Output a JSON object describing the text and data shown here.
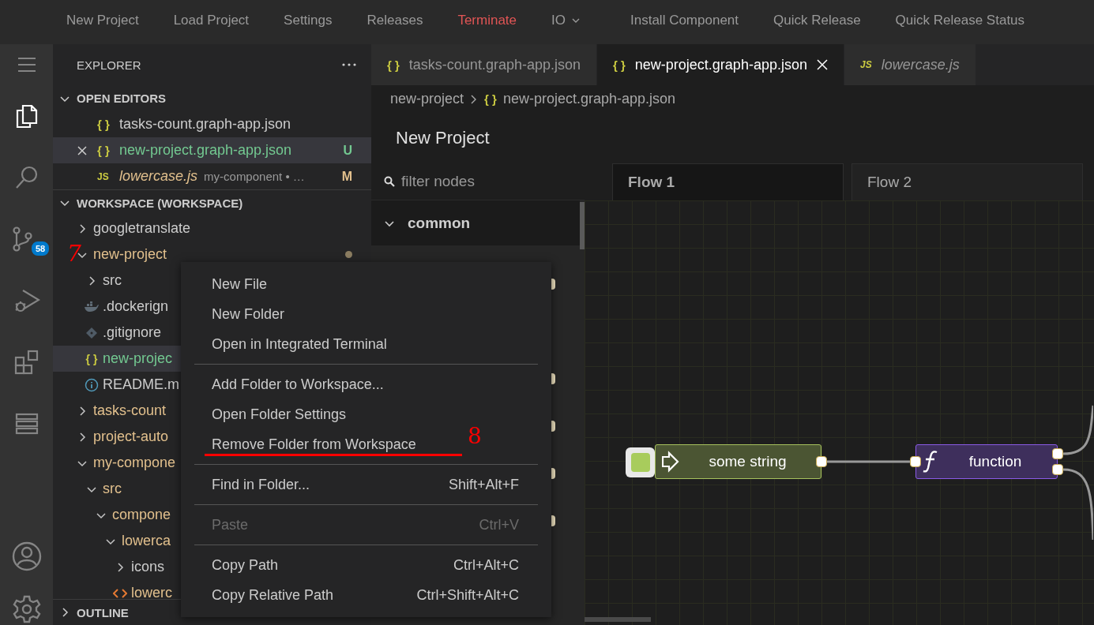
{
  "menu_bar": [
    {
      "label": "New Project",
      "danger": false,
      "dropdown": false
    },
    {
      "label": "Load Project",
      "danger": false,
      "dropdown": false
    },
    {
      "label": "Settings",
      "danger": false,
      "dropdown": false
    },
    {
      "label": "Releases",
      "danger": false,
      "dropdown": false
    },
    {
      "label": "Terminate",
      "danger": true,
      "dropdown": false
    },
    {
      "label": "IO",
      "danger": false,
      "dropdown": true
    },
    {
      "label": "Install Component",
      "danger": false,
      "dropdown": false
    },
    {
      "label": "Quick Release",
      "danger": false,
      "dropdown": false
    },
    {
      "label": "Quick Release Status",
      "danger": false,
      "dropdown": false
    }
  ],
  "activity_bar": {
    "items": [
      {
        "kind": "menu",
        "selected": false
      },
      {
        "kind": "files",
        "selected": true
      },
      {
        "kind": "search",
        "selected": false
      },
      {
        "kind": "source-control",
        "selected": false,
        "badge": "58"
      },
      {
        "kind": "debug",
        "selected": false
      },
      {
        "kind": "extensions",
        "selected": false
      },
      {
        "kind": "ruler",
        "selected": false
      }
    ],
    "bottom": [
      {
        "kind": "account",
        "selected": false
      },
      {
        "kind": "settings",
        "selected": false
      }
    ]
  },
  "explorer": {
    "title": "EXPLORER"
  },
  "open_editors": {
    "title": "OPEN EDITORS",
    "expanded": true,
    "items": [
      {
        "kind": "json",
        "icon": "{ }",
        "name": "tasks-count.graph-app.json",
        "selected": false,
        "preview": false,
        "close": false,
        "color": "#cccccc"
      },
      {
        "kind": "json",
        "icon": "{ }",
        "name": "new-project.graph-app.json",
        "selected": true,
        "preview": false,
        "close": true,
        "badge": "U",
        "color": "#73c991"
      },
      {
        "kind": "js",
        "icon": "JS",
        "name": "lowercase.js",
        "description": "my-component • …",
        "selected": false,
        "preview": true,
        "close": false,
        "badge": "M",
        "color": "#e2c08d"
      }
    ]
  },
  "workspace": {
    "title": "WORKSPACE (WORKSPACE)",
    "expanded": true,
    "items": [
      {
        "kind": "folder",
        "name": "googletranslate",
        "expanded": false,
        "selected": false,
        "color": "#cccccc"
      },
      {
        "kind": "folder",
        "name": "new-project",
        "expanded": true,
        "selected": false,
        "dot": true,
        "color": "#e2c08d",
        "children": [
          {
            "kind": "folder",
            "name": "src",
            "expanded": false,
            "selected": false,
            "color": "#cccccc"
          },
          {
            "kind": "docker",
            "name": ".dockerign",
            "selected": false,
            "color": "#cccccc"
          },
          {
            "kind": "git",
            "name": ".gitignore",
            "selected": false,
            "color": "#cccccc"
          },
          {
            "kind": "json",
            "icon": "{ }",
            "name": "new-projec",
            "selected": true,
            "color": "#73c991"
          },
          {
            "kind": "info",
            "name": "README.m",
            "selected": false,
            "color": "#cccccc"
          }
        ]
      },
      {
        "kind": "folder",
        "name": "tasks-count",
        "expanded": false,
        "selected": false,
        "color": "#e2c08d"
      },
      {
        "kind": "folder",
        "name": "project-auto",
        "expanded": false,
        "selected": false,
        "color": "#e2c08d"
      },
      {
        "kind": "folder",
        "name": "my-compone",
        "expanded": true,
        "selected": false,
        "color": "#e2c08d",
        "children": [
          {
            "kind": "folder",
            "name": "src",
            "expanded": true,
            "selected": false,
            "color": "#e2c08d",
            "children": [
              {
                "kind": "folder",
                "name": "compone",
                "expanded": true,
                "selected": false,
                "color": "#e2c08d",
                "children": [
                  {
                    "kind": "folder",
                    "name": "lowerca",
                    "expanded": true,
                    "selected": false,
                    "color": "#e2c08d",
                    "children": [
                      {
                        "kind": "folder",
                        "name": "icons",
                        "expanded": false,
                        "selected": false,
                        "color": "#cccccc"
                      },
                      {
                        "kind": "html",
                        "name": "lowerc",
                        "selected": false,
                        "color": "#e2c08d"
                      }
                    ]
                  }
                ]
              }
            ]
          }
        ]
      }
    ]
  },
  "outline": {
    "title": "OUTLINE",
    "expanded": false
  },
  "editor": {
    "tabs": [
      {
        "kind": "json",
        "icon": "{ }",
        "label": "tasks-count.graph-app.json",
        "selected": false,
        "preview": false,
        "close": false
      },
      {
        "kind": "json",
        "icon": "{ }",
        "label": "new-project.graph-app.json",
        "selected": true,
        "preview": false,
        "close": true
      },
      {
        "kind": "js",
        "icon": "JS",
        "label": "lowercase.js",
        "selected": false,
        "preview": true,
        "close": false
      }
    ],
    "breadcrumb": [
      {
        "label": "new-project"
      },
      {
        "kind": "json",
        "icon": "{ }",
        "label": "new-project.graph-app.json"
      }
    ]
  },
  "app": {
    "title": "New Project",
    "filter": {
      "placeholder": "filter nodes"
    },
    "flows": [
      {
        "label": "Flow 1",
        "selected": true
      },
      {
        "label": "Flow 2",
        "selected": false
      }
    ],
    "palette": {
      "category": "common",
      "expanded": true
    },
    "nodes": [
      {
        "kind": "inject",
        "label": "some string",
        "color": "#4b5533"
      },
      {
        "kind": "function",
        "label": "function",
        "color": "#3e2f5c"
      }
    ]
  },
  "context_menu": {
    "groups": [
      [
        {
          "label": "New File",
          "disabled": false
        },
        {
          "label": "New Folder",
          "disabled": false
        },
        {
          "label": "Open in Integrated Terminal",
          "disabled": false
        }
      ],
      [
        {
          "label": "Add Folder to Workspace...",
          "disabled": false
        },
        {
          "label": "Open Folder Settings",
          "disabled": false
        },
        {
          "label": "Remove Folder from Workspace",
          "disabled": false
        }
      ],
      [
        {
          "label": "Find in Folder...",
          "shortcut": "Shift+Alt+F",
          "disabled": false
        }
      ],
      [
        {
          "label": "Paste",
          "shortcut": "Ctrl+V",
          "disabled": true
        }
      ],
      [
        {
          "label": "Copy Path",
          "shortcut": "Ctrl+Alt+C",
          "disabled": false
        },
        {
          "label": "Copy Relative Path",
          "shortcut": "Ctrl+Shift+Alt+C",
          "disabled": false
        }
      ]
    ]
  },
  "annotations": [
    {
      "text": "7"
    },
    {
      "text": "8"
    }
  ]
}
